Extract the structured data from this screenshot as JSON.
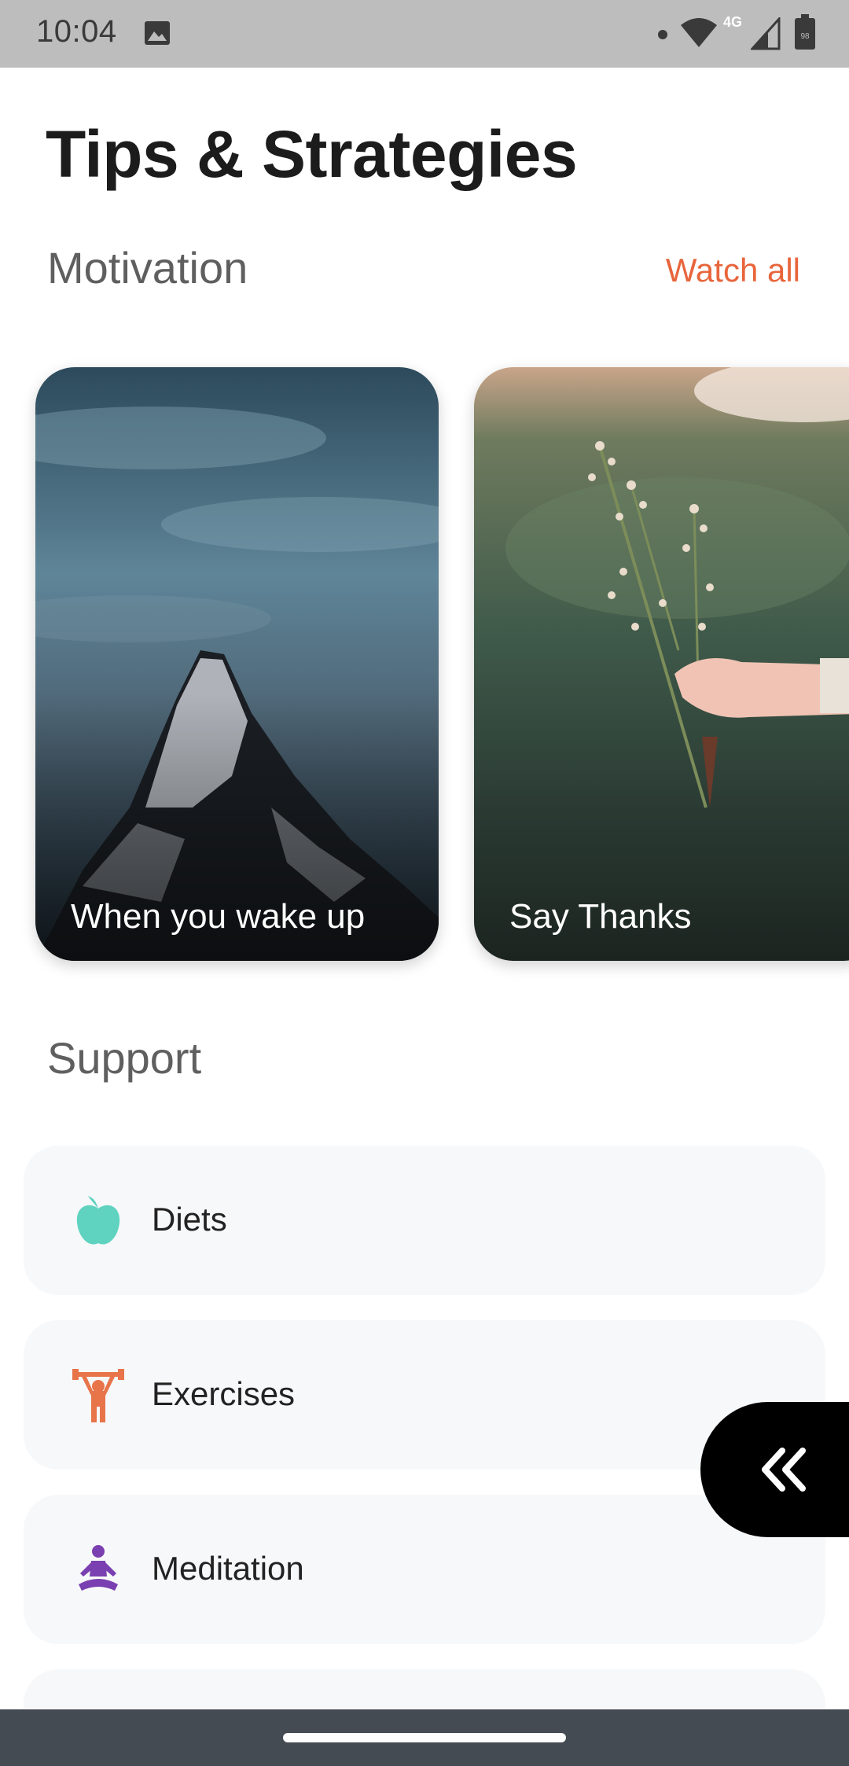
{
  "status_bar": {
    "time": "10:04",
    "network": "4G",
    "battery": "98",
    "icons": [
      "image-icon",
      "dot-icon",
      "wifi-icon",
      "signal-icon",
      "battery-icon"
    ]
  },
  "page": {
    "title": "Tips & Strategies"
  },
  "motivation": {
    "title": "Motivation",
    "watch_all": "Watch all",
    "cards": [
      {
        "label": "When you wake up",
        "image": "mountain-peak-clouds"
      },
      {
        "label": "Say Thanks",
        "image": "hand-holding-wildflowers"
      }
    ]
  },
  "support": {
    "title": "Support",
    "items": [
      {
        "label": "Diets",
        "icon": "apple-icon",
        "color": "#5fd3c0"
      },
      {
        "label": "Exercises",
        "icon": "weightlifter-icon",
        "color": "#e8744a"
      },
      {
        "label": "Meditation",
        "icon": "meditation-icon",
        "color": "#7a3fb0"
      }
    ]
  },
  "floating_button": {
    "icon": "double-chevron-left-icon"
  },
  "colors": {
    "accent": "#e8653c",
    "status_bar": "#bdbdbd",
    "nav_bar": "#454b52",
    "list_bg": "#f7f8fa"
  }
}
